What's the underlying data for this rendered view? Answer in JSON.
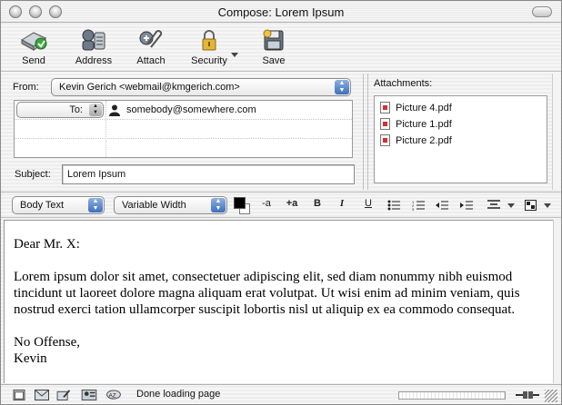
{
  "window": {
    "title": "Compose: Lorem Ipsum"
  },
  "toolbar": {
    "send_label": "Send",
    "address_label": "Address",
    "attach_label": "Attach",
    "security_label": "Security",
    "save_label": "Save"
  },
  "header": {
    "from_label": "From:",
    "from_value": "Kevin Gerich <webmail@kmgerich.com>",
    "to_type": "To:",
    "to_value": "somebody@somewhere.com",
    "subject_label": "Subject:",
    "subject_value": "Lorem Ipsum"
  },
  "attachments": {
    "label": "Attachments:",
    "items": [
      "Picture 4.pdf",
      "Picture 1.pdf",
      "Picture 2.pdf"
    ]
  },
  "format": {
    "paragraph_style": "Body Text",
    "font": "Variable Width",
    "text_color": "#000000",
    "smaller_label": "-a",
    "larger_label": "+a",
    "bold_label": "B",
    "italic_label": "I",
    "underline_label": "U"
  },
  "message": {
    "greeting": "Dear Mr. X:",
    "paragraph": "Lorem ipsum dolor sit amet, consectetuer adipiscing elit, sed diam nonummy nibh euismod tincidunt ut laoreet dolore magna aliquam erat volutpat. Ut wisi enim ad minim veniam, quis nostrud exerci tation ullamcorper suscipit lobortis nisl ut aliquip ex ea commodo consequat.",
    "closing_line1": "No Offense,",
    "closing_line2": "Kevin"
  },
  "status": {
    "text": "Done loading page"
  }
}
